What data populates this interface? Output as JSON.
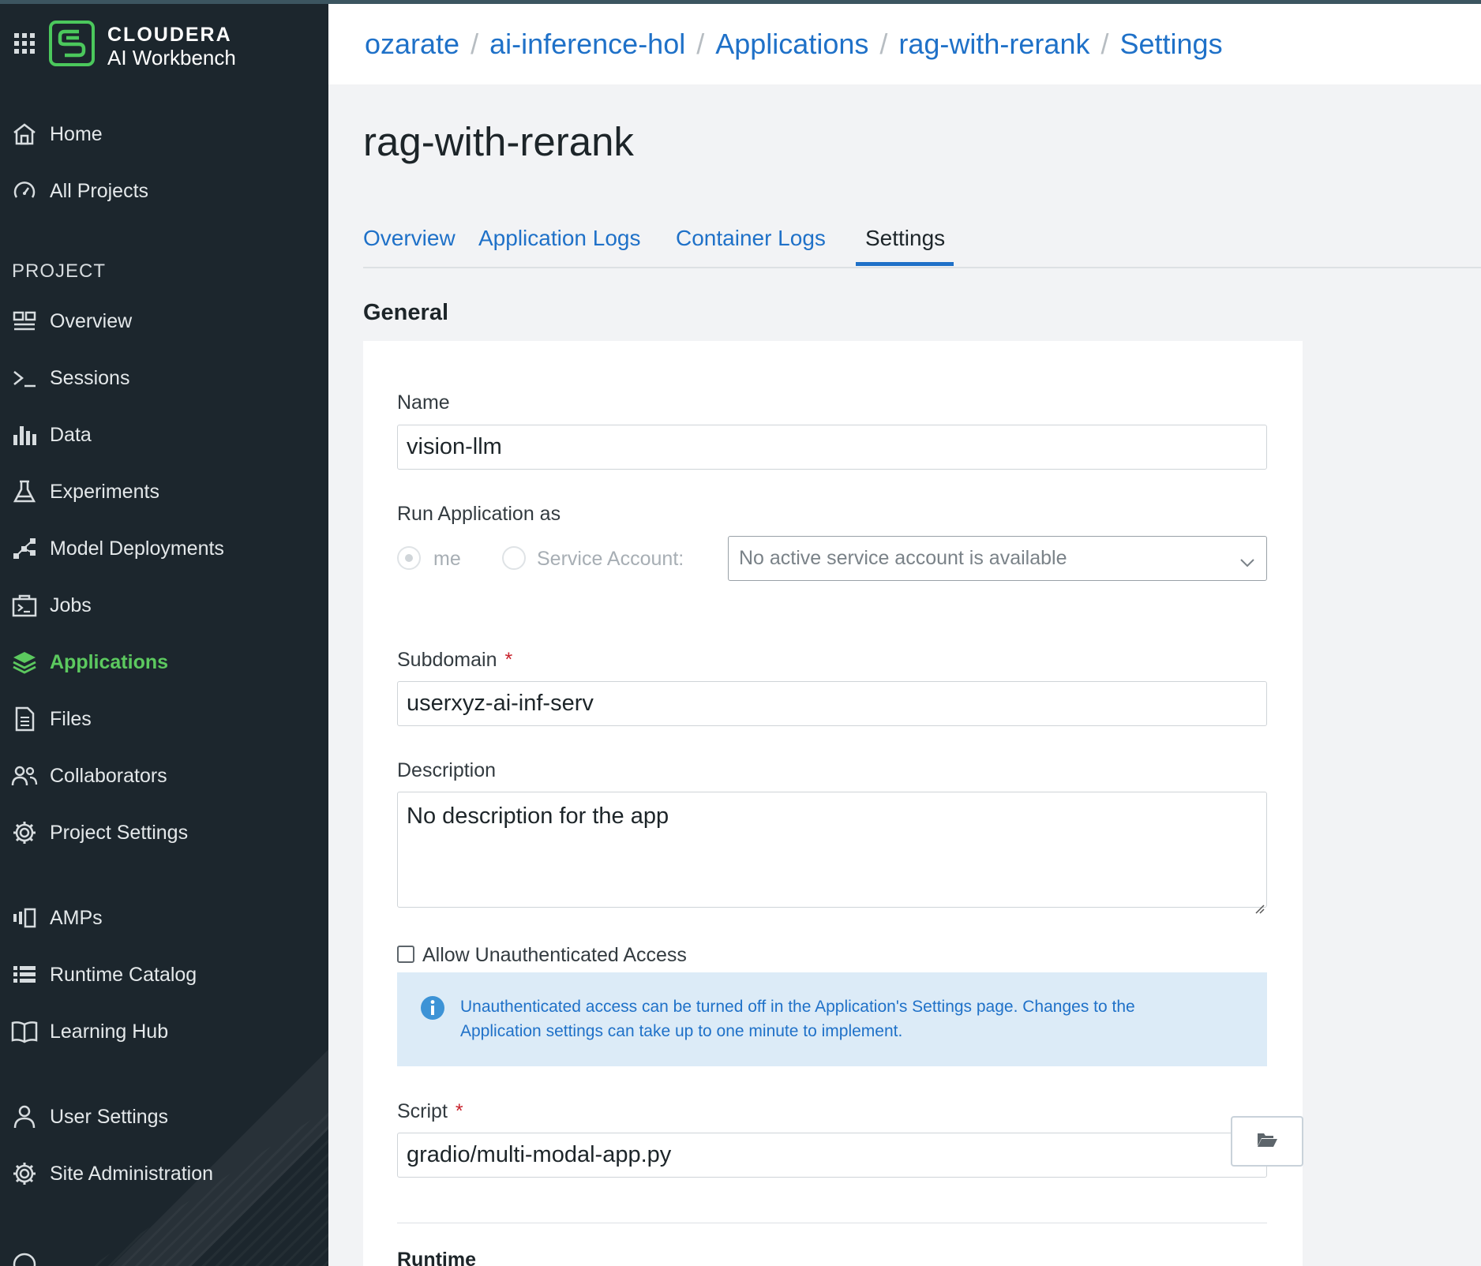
{
  "brand": {
    "name": "CLOUDERA",
    "subtitle": "AI Workbench",
    "accent_color": "#4bc85c"
  },
  "sidebar": {
    "top_items": [
      {
        "label": "Home",
        "icon": "home-icon"
      },
      {
        "label": "All Projects",
        "icon": "gauge-icon"
      }
    ],
    "section_label": "PROJECT",
    "project_items": [
      {
        "label": "Overview",
        "icon": "overview-icon"
      },
      {
        "label": "Sessions",
        "icon": "terminal-icon"
      },
      {
        "label": "Data",
        "icon": "bar-chart-icon"
      },
      {
        "label": "Experiments",
        "icon": "flask-icon"
      },
      {
        "label": "Model Deployments",
        "icon": "network-icon"
      },
      {
        "label": "Jobs",
        "icon": "jobs-icon"
      },
      {
        "label": "Applications",
        "icon": "layers-icon",
        "active": true
      },
      {
        "label": "Files",
        "icon": "file-icon"
      },
      {
        "label": "Collaborators",
        "icon": "users-icon"
      },
      {
        "label": "Project Settings",
        "icon": "gear-icon"
      }
    ],
    "bottom_items": [
      {
        "label": "AMPs",
        "icon": "amps-icon"
      },
      {
        "label": "Runtime Catalog",
        "icon": "list-icon"
      },
      {
        "label": "Learning Hub",
        "icon": "book-icon"
      }
    ],
    "footer_items": [
      {
        "label": "User Settings",
        "icon": "user-icon"
      },
      {
        "label": "Site Administration",
        "icon": "gear-icon"
      }
    ],
    "active_color": "#5cc95f"
  },
  "breadcrumb": [
    "ozarate",
    "ai-inference-hol",
    "Applications",
    "rag-with-rerank",
    "Settings"
  ],
  "page": {
    "title": "rag-with-rerank",
    "tabs": [
      {
        "label": "Overview"
      },
      {
        "label": "Application Logs"
      },
      {
        "label": "Container Logs"
      },
      {
        "label": "Settings",
        "active": true
      }
    ],
    "section_title": "General"
  },
  "form": {
    "name_label": "Name",
    "name_value": "vision-llm",
    "run_as_label": "Run Application as",
    "run_as_me": "me",
    "run_as_service": "Service Account:",
    "service_account_placeholder": "No active service account is available",
    "subdomain_label": "Subdomain",
    "subdomain_value": "userxyz-ai-inf-serv",
    "description_label": "Description",
    "description_value": "No description for the app",
    "allow_unauth_label": "Allow Unauthenticated Access",
    "allow_unauth_checked": false,
    "info_text": "Unauthenticated access can be turned off in the Application's Settings page. Changes to the Application settings can take up to one minute to implement.",
    "script_label": "Script",
    "script_value": "gradio/multi-modal-app.py",
    "runtime_label": "Runtime"
  },
  "colors": {
    "link": "#1f71c8",
    "required": "#c8222c",
    "info_bg": "#dcebf7",
    "sidebar_bg": "#1c262d"
  }
}
